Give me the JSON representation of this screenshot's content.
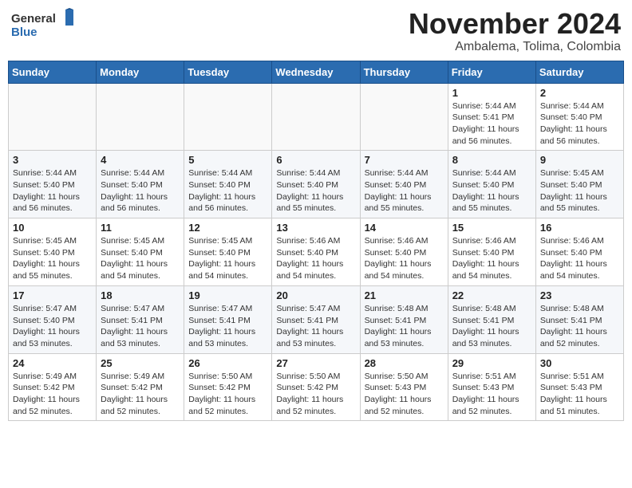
{
  "header": {
    "logo_general": "General",
    "logo_blue": "Blue",
    "month_title": "November 2024",
    "subtitle": "Ambalema, Tolima, Colombia"
  },
  "weekdays": [
    "Sunday",
    "Monday",
    "Tuesday",
    "Wednesday",
    "Thursday",
    "Friday",
    "Saturday"
  ],
  "weeks": [
    [
      {
        "day": "",
        "info": ""
      },
      {
        "day": "",
        "info": ""
      },
      {
        "day": "",
        "info": ""
      },
      {
        "day": "",
        "info": ""
      },
      {
        "day": "",
        "info": ""
      },
      {
        "day": "1",
        "info": "Sunrise: 5:44 AM\nSunset: 5:41 PM\nDaylight: 11 hours and 56 minutes."
      },
      {
        "day": "2",
        "info": "Sunrise: 5:44 AM\nSunset: 5:40 PM\nDaylight: 11 hours and 56 minutes."
      }
    ],
    [
      {
        "day": "3",
        "info": "Sunrise: 5:44 AM\nSunset: 5:40 PM\nDaylight: 11 hours and 56 minutes."
      },
      {
        "day": "4",
        "info": "Sunrise: 5:44 AM\nSunset: 5:40 PM\nDaylight: 11 hours and 56 minutes."
      },
      {
        "day": "5",
        "info": "Sunrise: 5:44 AM\nSunset: 5:40 PM\nDaylight: 11 hours and 56 minutes."
      },
      {
        "day": "6",
        "info": "Sunrise: 5:44 AM\nSunset: 5:40 PM\nDaylight: 11 hours and 55 minutes."
      },
      {
        "day": "7",
        "info": "Sunrise: 5:44 AM\nSunset: 5:40 PM\nDaylight: 11 hours and 55 minutes."
      },
      {
        "day": "8",
        "info": "Sunrise: 5:44 AM\nSunset: 5:40 PM\nDaylight: 11 hours and 55 minutes."
      },
      {
        "day": "9",
        "info": "Sunrise: 5:45 AM\nSunset: 5:40 PM\nDaylight: 11 hours and 55 minutes."
      }
    ],
    [
      {
        "day": "10",
        "info": "Sunrise: 5:45 AM\nSunset: 5:40 PM\nDaylight: 11 hours and 55 minutes."
      },
      {
        "day": "11",
        "info": "Sunrise: 5:45 AM\nSunset: 5:40 PM\nDaylight: 11 hours and 54 minutes."
      },
      {
        "day": "12",
        "info": "Sunrise: 5:45 AM\nSunset: 5:40 PM\nDaylight: 11 hours and 54 minutes."
      },
      {
        "day": "13",
        "info": "Sunrise: 5:46 AM\nSunset: 5:40 PM\nDaylight: 11 hours and 54 minutes."
      },
      {
        "day": "14",
        "info": "Sunrise: 5:46 AM\nSunset: 5:40 PM\nDaylight: 11 hours and 54 minutes."
      },
      {
        "day": "15",
        "info": "Sunrise: 5:46 AM\nSunset: 5:40 PM\nDaylight: 11 hours and 54 minutes."
      },
      {
        "day": "16",
        "info": "Sunrise: 5:46 AM\nSunset: 5:40 PM\nDaylight: 11 hours and 54 minutes."
      }
    ],
    [
      {
        "day": "17",
        "info": "Sunrise: 5:47 AM\nSunset: 5:40 PM\nDaylight: 11 hours and 53 minutes."
      },
      {
        "day": "18",
        "info": "Sunrise: 5:47 AM\nSunset: 5:41 PM\nDaylight: 11 hours and 53 minutes."
      },
      {
        "day": "19",
        "info": "Sunrise: 5:47 AM\nSunset: 5:41 PM\nDaylight: 11 hours and 53 minutes."
      },
      {
        "day": "20",
        "info": "Sunrise: 5:47 AM\nSunset: 5:41 PM\nDaylight: 11 hours and 53 minutes."
      },
      {
        "day": "21",
        "info": "Sunrise: 5:48 AM\nSunset: 5:41 PM\nDaylight: 11 hours and 53 minutes."
      },
      {
        "day": "22",
        "info": "Sunrise: 5:48 AM\nSunset: 5:41 PM\nDaylight: 11 hours and 53 minutes."
      },
      {
        "day": "23",
        "info": "Sunrise: 5:48 AM\nSunset: 5:41 PM\nDaylight: 11 hours and 52 minutes."
      }
    ],
    [
      {
        "day": "24",
        "info": "Sunrise: 5:49 AM\nSunset: 5:42 PM\nDaylight: 11 hours and 52 minutes."
      },
      {
        "day": "25",
        "info": "Sunrise: 5:49 AM\nSunset: 5:42 PM\nDaylight: 11 hours and 52 minutes."
      },
      {
        "day": "26",
        "info": "Sunrise: 5:50 AM\nSunset: 5:42 PM\nDaylight: 11 hours and 52 minutes."
      },
      {
        "day": "27",
        "info": "Sunrise: 5:50 AM\nSunset: 5:42 PM\nDaylight: 11 hours and 52 minutes."
      },
      {
        "day": "28",
        "info": "Sunrise: 5:50 AM\nSunset: 5:43 PM\nDaylight: 11 hours and 52 minutes."
      },
      {
        "day": "29",
        "info": "Sunrise: 5:51 AM\nSunset: 5:43 PM\nDaylight: 11 hours and 52 minutes."
      },
      {
        "day": "30",
        "info": "Sunrise: 5:51 AM\nSunset: 5:43 PM\nDaylight: 11 hours and 51 minutes."
      }
    ]
  ]
}
